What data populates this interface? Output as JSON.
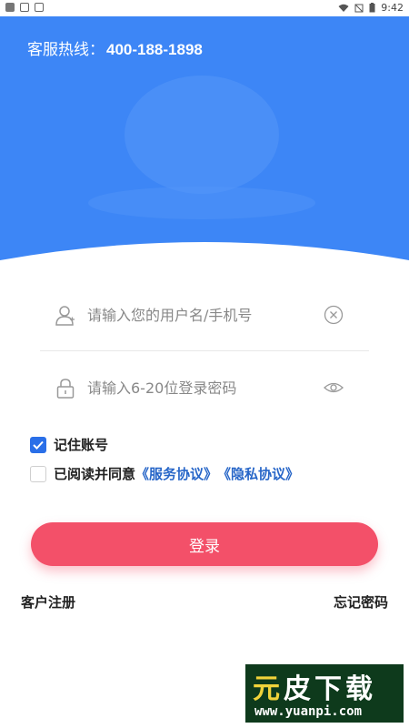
{
  "status_bar": {
    "time": "9:42"
  },
  "header": {
    "hotline_label": "客服热线：",
    "hotline_number": "400-188-1898",
    "bg_color": "#3d86f6"
  },
  "form": {
    "username_placeholder": "请输入您的用户名/手机号",
    "password_placeholder": "请输入6-20位登录密码",
    "remember_label": "记住账号",
    "remember_checked": true,
    "agree_prefix": "已阅读并同意",
    "service_agreement": "《服务协议》",
    "privacy_agreement": "《隐私协议》",
    "agree_checked": false,
    "login_label": "登录",
    "register_label": "客户注册",
    "forgot_label": "忘记密码"
  },
  "watermark": {
    "title_a": "元",
    "title_b": "皮下载",
    "url": "www.yuanpi.com"
  },
  "colors": {
    "accent": "#3d86f6",
    "login_button": "#f35069",
    "link": "#2766c8",
    "checkbox": "#2a6fe8"
  }
}
